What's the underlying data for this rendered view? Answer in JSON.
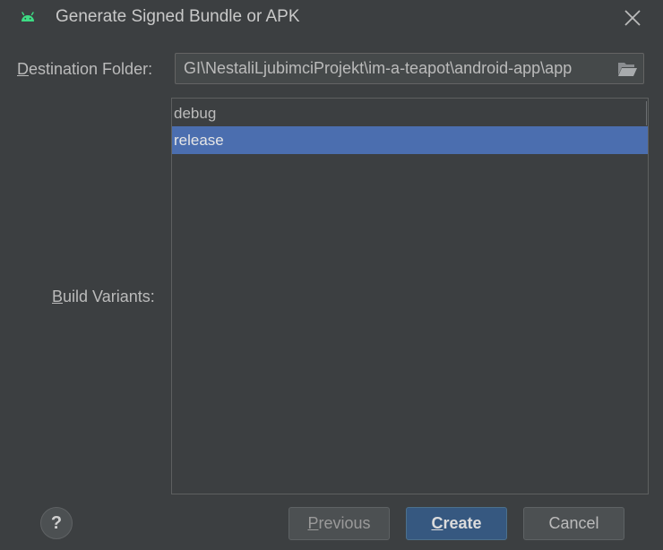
{
  "window": {
    "title": "Generate Signed Bundle or APK",
    "app_icon": "android-icon",
    "close_icon": "close-icon"
  },
  "destination": {
    "label_mnemonic": "D",
    "label_rest": "estination Folder:",
    "path": "GI\\NestaliLjubimciProjekt\\im-a-teapot\\android-app\\app",
    "browse_icon": "folder-open-icon"
  },
  "build_variants": {
    "label_mnemonic": "B",
    "label_rest": "uild Variants:",
    "items": [
      {
        "label": "debug",
        "selected": false
      },
      {
        "label": "release",
        "selected": true
      }
    ]
  },
  "footer": {
    "help_label": "?",
    "previous_mnemonic": "P",
    "previous_rest": "revious",
    "create_mnemonic": "C",
    "create_rest": "reate",
    "cancel_label": "Cancel"
  },
  "colors": {
    "background": "#3c3f41",
    "selection": "#4b6eaf",
    "primary_button": "#365880",
    "android_green": "#3ddc84"
  }
}
